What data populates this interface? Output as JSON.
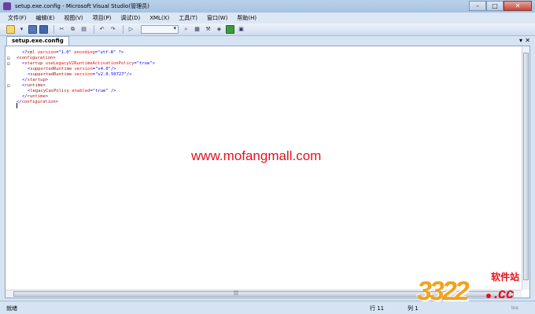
{
  "window": {
    "title": "setup.exe.config - Microsoft Visual Studio(管理员)",
    "controls": {
      "minimize": "–",
      "maximize": "□",
      "close": "✕"
    }
  },
  "menubar": {
    "items": [
      "文件(F)",
      "编辑(E)",
      "视图(V)",
      "项目(P)",
      "调试(D)",
      "XML(X)",
      "工具(T)",
      "窗口(W)",
      "帮助(H)"
    ]
  },
  "toolbar": {
    "icons": [
      "new-project-icon",
      "add-item-icon",
      "save-icon",
      "save-all-icon",
      "cut-icon",
      "copy-icon",
      "paste-icon",
      "undo-icon",
      "redo-icon",
      "start-debug-icon",
      "find-icon",
      "properties-icon",
      "toolbox-icon",
      "object-browser-icon",
      "start-page-icon",
      "more-icon"
    ],
    "combo_value": ""
  },
  "tabs": [
    {
      "label": "setup.exe.config"
    }
  ],
  "tab_controls": {
    "dropdown": "▾",
    "close": "✕"
  },
  "editor": {
    "lines": [
      {
        "fold": "",
        "indent": 1,
        "parts": [
          [
            "blue",
            "<?"
          ],
          [
            "red",
            "xml"
          ],
          [
            "attr",
            " version"
          ],
          [
            "blue",
            "=\"1.0\""
          ],
          [
            "attr",
            " encoding"
          ],
          [
            "blue",
            "=\"utf-8\""
          ],
          [
            "blue",
            " ?>"
          ]
        ]
      },
      {
        "fold": "⊟",
        "indent": 0,
        "parts": [
          [
            "blue",
            "<"
          ],
          [
            "red",
            "configuration"
          ],
          [
            "blue",
            ">"
          ]
        ]
      },
      {
        "fold": "⊟",
        "indent": 1,
        "parts": [
          [
            "blue",
            "<"
          ],
          [
            "red",
            "startup"
          ],
          [
            "attr",
            " useLegacyV2RuntimeActivationPolicy"
          ],
          [
            "blue",
            "=\"true\">"
          ]
        ]
      },
      {
        "fold": "",
        "indent": 2,
        "parts": [
          [
            "blue",
            "<"
          ],
          [
            "red",
            "supportedRuntime"
          ],
          [
            "attr",
            " version"
          ],
          [
            "blue",
            "=\"v4.0\"/>"
          ]
        ]
      },
      {
        "fold": "",
        "indent": 2,
        "parts": [
          [
            "blue",
            "<"
          ],
          [
            "red",
            "supportedRuntime"
          ],
          [
            "attr",
            " version"
          ],
          [
            "blue",
            "=\"v2.0.50727\"/>"
          ]
        ]
      },
      {
        "fold": "",
        "indent": 1,
        "parts": [
          [
            "blue",
            "</"
          ],
          [
            "red",
            "startup"
          ],
          [
            "blue",
            ">"
          ]
        ]
      },
      {
        "fold": "⊟",
        "indent": 1,
        "parts": [
          [
            "blue",
            "<"
          ],
          [
            "red",
            "runtime"
          ],
          [
            "blue",
            ">"
          ]
        ]
      },
      {
        "fold": "",
        "indent": 2,
        "parts": [
          [
            "blue",
            "<"
          ],
          [
            "red",
            "legacyCasPolicy"
          ],
          [
            "attr",
            " enabled"
          ],
          [
            "blue",
            "=\"true\" />"
          ]
        ]
      },
      {
        "fold": "",
        "indent": 1,
        "parts": [
          [
            "blue",
            "</"
          ],
          [
            "red",
            "runtime"
          ],
          [
            "blue",
            ">"
          ]
        ]
      },
      {
        "fold": "",
        "indent": 0,
        "parts": [
          [
            "blue",
            "</"
          ],
          [
            "red",
            "configuration"
          ],
          [
            "blue",
            ">"
          ]
        ]
      }
    ],
    "colors": {
      "blue": "#0000ff",
      "red": "#a31515",
      "attr": "#ff0000"
    }
  },
  "watermark": {
    "url": "www.mofangmall.com"
  },
  "statusbar": {
    "ready": "就绪",
    "row": "行 11",
    "col": "列 1",
    "ins": "Ins"
  },
  "logo": {
    "digits": "3322",
    "cn": "软件站",
    "domain": ".cc",
    "colors": {
      "orange": "#f2a21b",
      "red": "#e8101a"
    }
  }
}
